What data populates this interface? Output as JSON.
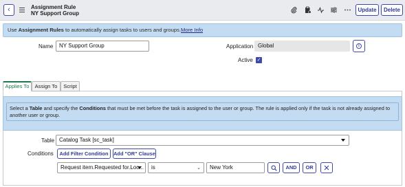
{
  "header": {
    "title": "Assignment Rule",
    "subtitle": "NY Support Group",
    "back_icon": "chevron-left-icon",
    "menu_icon": "hamburger-icon",
    "toolbar_icons": [
      "paperclip-icon",
      "clipboard-icon",
      "activity-icon",
      "sliders-icon",
      "more-icon"
    ],
    "update_label": "Update",
    "delete_label": "Delete"
  },
  "banner": {
    "prefix": "Use ",
    "bold": "Assignment Rules",
    "rest": " to automatically assign tasks to users and groups.",
    "link": "More Info"
  },
  "form": {
    "name_label": "Name",
    "name_value": "NY Support Group",
    "application_label": "Application",
    "application_value": "Global",
    "active_label": "Active",
    "active_checked": true
  },
  "tabs": [
    {
      "label": "Applies To",
      "active": true
    },
    {
      "label": "Assign To",
      "active": false
    },
    {
      "label": "Script",
      "active": false
    }
  ],
  "tab_info": {
    "p1": "Select a ",
    "b1": "Table",
    "p2": " and specify the ",
    "b2": "Conditions",
    "p3": " that must be met before the task is assigned to the user or group. The rule is applied only if the task is not already assigned to",
    "line2": "another user or group."
  },
  "table_field": {
    "label": "Table",
    "value": "Catalog Task [sc_task]"
  },
  "conditions": {
    "label": "Conditions",
    "add_filter_label": "Add Filter Condition",
    "add_or_label": "Add \"OR\" Clause",
    "field_value": "Request item.Requested for.Loc...",
    "operator_value": "is",
    "value": "New York",
    "and_label": "AND",
    "or_label": "OR"
  },
  "colors": {
    "accent": "#3f4aa8",
    "banner": "#c3dcf1",
    "active_tab": "#1a7a4c"
  }
}
